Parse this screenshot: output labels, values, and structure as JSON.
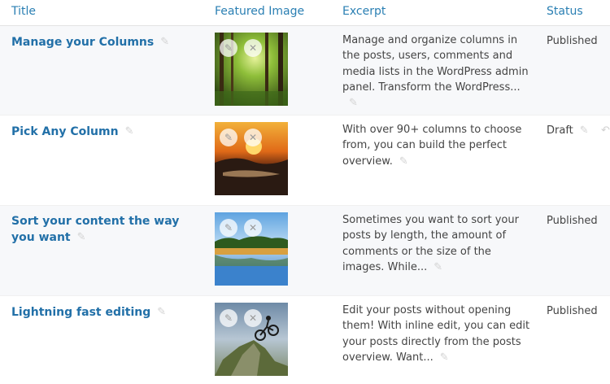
{
  "columns": {
    "title": "Title",
    "featured_image": "Featured Image",
    "excerpt": "Excerpt",
    "status": "Status"
  },
  "icons": {
    "edit": "pencil-icon",
    "remove": "close-icon",
    "undo": "undo-icon"
  },
  "colors": {
    "link": "#2270a8",
    "header_link": "#2a7fb3",
    "row_alt": "#f7f8fa"
  },
  "rows": [
    {
      "title": "Manage your Columns",
      "excerpt": "Manage and organize columns in the posts, users, comments and media lists in the WordPress admin panel. Transform the WordPress...",
      "status": "Published",
      "image": "forest"
    },
    {
      "title": "Pick Any Column",
      "excerpt": "With over 90+ columns to choose from, you can build the perfect overview.",
      "status": "Draft",
      "image": "sunset"
    },
    {
      "title": "Sort your content the way you want",
      "excerpt": "Sometimes you want to sort your posts by length, the amount of comments or the size of the images. While...",
      "status": "Published",
      "image": "lake"
    },
    {
      "title": "Lightning fast editing",
      "excerpt": "Edit your posts without opening them! With inline edit, you can edit your posts directly from the posts overview. Want...",
      "status": "Published",
      "image": "biker"
    }
  ]
}
